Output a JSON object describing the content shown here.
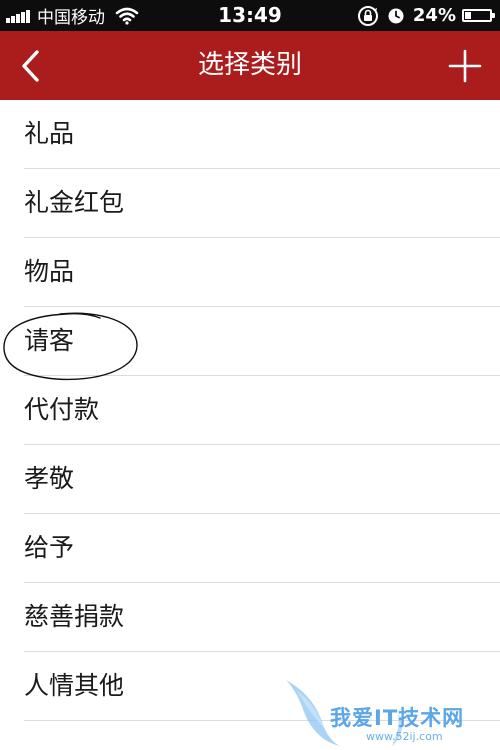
{
  "status_bar": {
    "carrier": "中国移动",
    "time": "13:49",
    "battery_percent": "24%",
    "battery_level": 0.24
  },
  "nav": {
    "title": "选择类别",
    "back_icon": "chevron-left-icon",
    "add_icon": "plus-icon"
  },
  "categories": [
    {
      "label": "礼品"
    },
    {
      "label": "礼金红包"
    },
    {
      "label": "物品"
    },
    {
      "label": "请客"
    },
    {
      "label": "代付款"
    },
    {
      "label": "孝敬"
    },
    {
      "label": "给予"
    },
    {
      "label": "慈善捐款"
    },
    {
      "label": "人情其他"
    }
  ],
  "watermark": {
    "text": "我爱IT技术网",
    "url": "www.52ij.com"
  },
  "colors": {
    "nav_background": "#ab1c1c",
    "status_background": "#0d0d0d",
    "separator": "#dcdcdc"
  }
}
